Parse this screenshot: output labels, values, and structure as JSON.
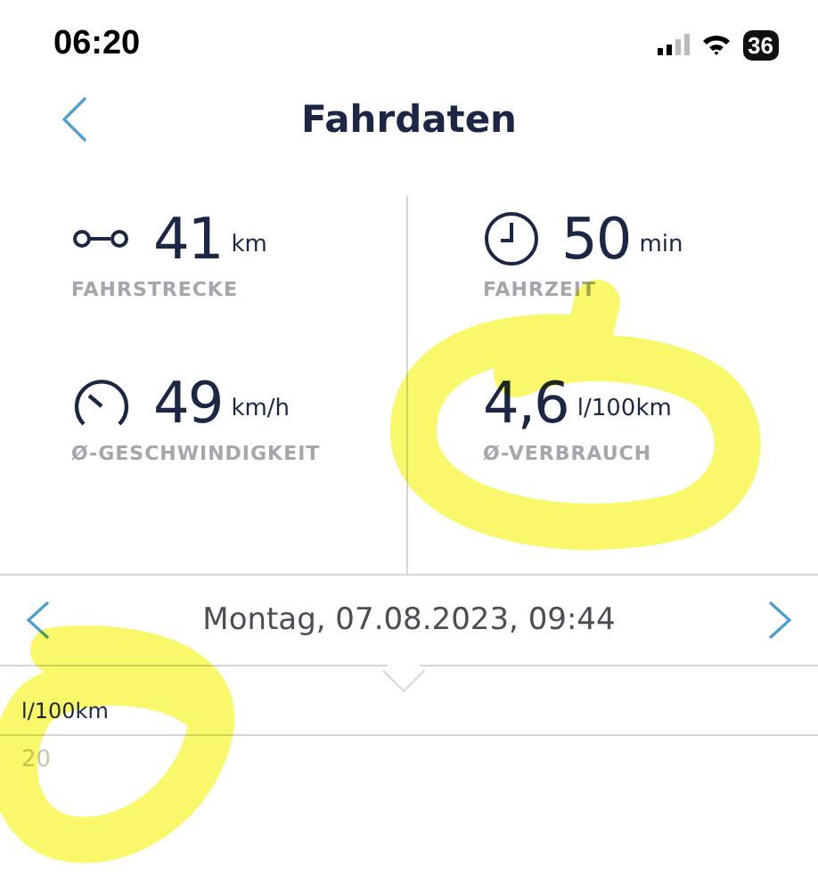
{
  "status_bar": {
    "time": "06:20",
    "battery": "36"
  },
  "nav": {
    "title": "Fahrdaten"
  },
  "stats": [
    {
      "kind": "route",
      "value": "41",
      "unit": "km",
      "label": "FAHRSTRECKE"
    },
    {
      "kind": "clock",
      "value": "50",
      "unit": "min",
      "label": "FAHRZEIT"
    },
    {
      "kind": "speed",
      "value": "49",
      "unit": "km/h",
      "label": "Ø-GESCHWINDIGKEIT"
    },
    {
      "kind": "plain",
      "value": "4,6",
      "unit": "l/100km",
      "label": "Ø-VERBRAUCH"
    }
  ],
  "trip_selector": {
    "date": "Montag, 07.08.2023, 09:44"
  },
  "chart": {
    "unit": "l/100km",
    "tick": "20"
  }
}
